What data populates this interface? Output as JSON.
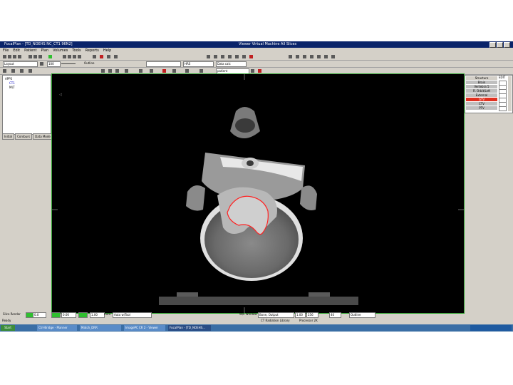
{
  "window": {
    "title": "FocalPlan - [TD_NOEHS NC_CT1 96N2]",
    "center_title": "Viewer    Virtual Machine    All Slices"
  },
  "menu": [
    "File",
    "Edit",
    "Patient",
    "Plan",
    "Volumes",
    "Tools",
    "Reports",
    "Help"
  ],
  "toolbar2": {
    "structure_select": "Layout",
    "zoom_value": "100",
    "zoom_unit": "Outline",
    "view_select": "HRS",
    "dose_select": "Data calc",
    "beam_select": "patient"
  },
  "left_panel": {
    "tree": [
      "APPS",
      "CT1",
      "MLT"
    ],
    "tabs": [
      "Initial",
      "Contours",
      "Data Mode"
    ]
  },
  "right_panel": {
    "header": "Structure",
    "header_col": "EDIT",
    "rows": [
      {
        "label": "Brain",
        "color": "#bfbfbf"
      },
      {
        "label": "Vertebra 5",
        "color": "#bfbfbf"
      },
      {
        "label": "R. Orbit/Left",
        "color": "#bfbfbf"
      },
      {
        "label": "External",
        "color": "#bfbfbf"
      },
      {
        "label": "GTV",
        "color": "#e03020"
      },
      {
        "label": "CTV",
        "color": "#bfbfbf"
      },
      {
        "label": "PTV",
        "color": "#bfbfbf"
      }
    ]
  },
  "bottom_bar": {
    "left_label": "Slice Render",
    "field1": "0.0",
    "field2": "0.00",
    "field3": "1.00",
    "mode_label": "Auto",
    "mode_select": "Auto w/Tool",
    "window_label": "W/L Window",
    "window_select": "Bone, Output",
    "field_a": "1.00",
    "field_b": "256",
    "field_c": "40",
    "right_select": "Outline"
  },
  "status": {
    "left": "Ready",
    "middle": "CT Radiation Library",
    "right": "Processor 2K"
  },
  "taskbar": {
    "start": "Start",
    "tasks": [
      {
        "label": "Ctrl-Bridge - Planner"
      },
      {
        "label": "Match_DRR"
      },
      {
        "label": "ImagePC CR 2 - Viewer"
      },
      {
        "label": "FocalPlan - [TD_NOEHS..."
      }
    ]
  },
  "image": {
    "contour_color": "#ff2222"
  }
}
